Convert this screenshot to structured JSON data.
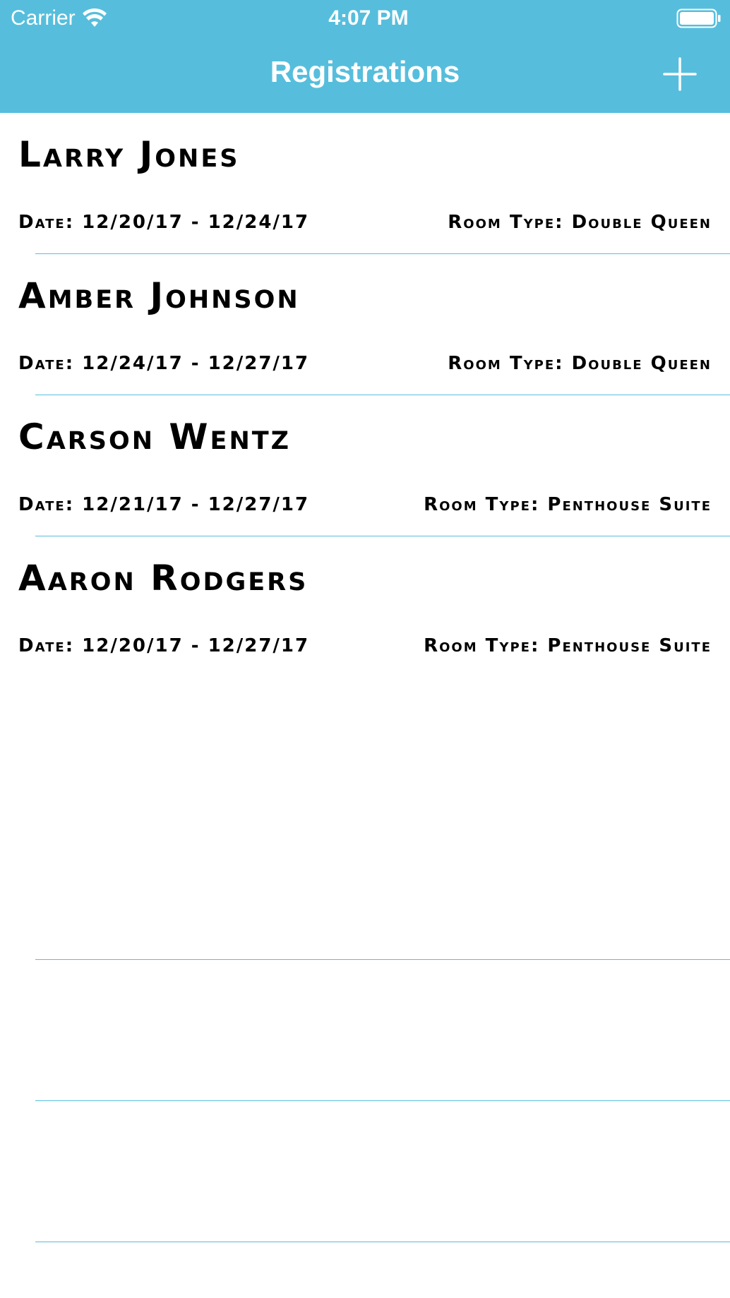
{
  "status_bar": {
    "carrier": "Carrier",
    "time": "4:07 PM"
  },
  "nav": {
    "title": "Registrations",
    "add_icon": "plus-icon",
    "background_color": "#56bedc"
  },
  "registrations": [
    {
      "name": "Larry Jones",
      "date": "Date: 12/20/17 - 12/24/17",
      "room": "Room Type: Double Queen"
    },
    {
      "name": "Amber Johnson",
      "date": "Date: 12/24/17 - 12/27/17",
      "room": "Room Type: Double Queen"
    },
    {
      "name": "Carson Wentz",
      "date": "Date: 12/21/17 - 12/27/17",
      "room": "Room Type: Penthouse Suite"
    },
    {
      "name": "Aaron Rodgers",
      "date": "Date: 12/20/17 - 12/27/17",
      "room": "Room Type: Penthouse Suite"
    }
  ]
}
